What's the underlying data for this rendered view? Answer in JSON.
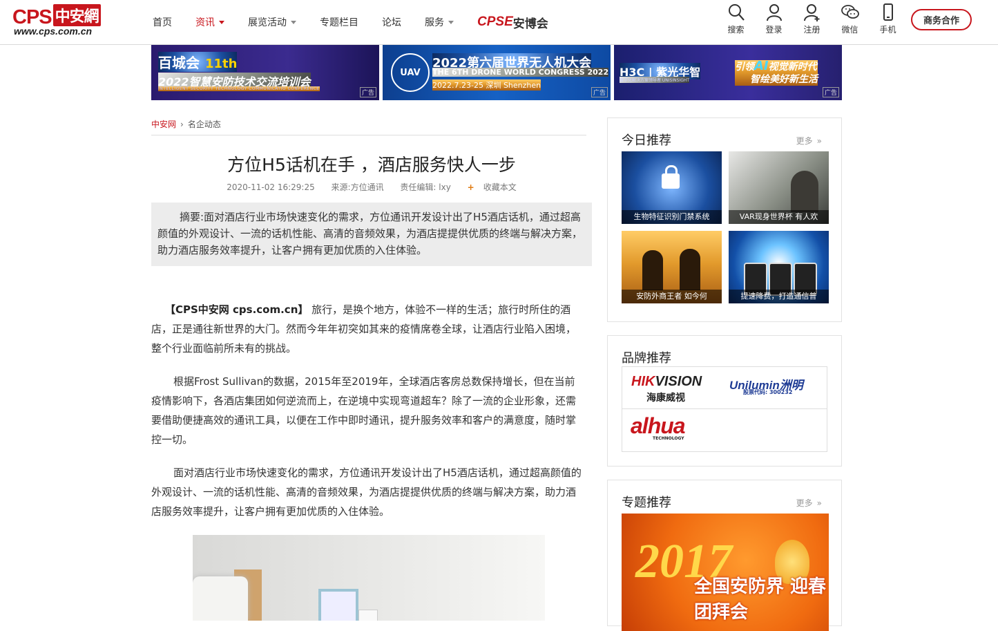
{
  "header": {
    "logo_cps": "CPS",
    "logo_cn": "中安網",
    "logo_url": "www.cps.com.cn",
    "nav": [
      {
        "label": "首页"
      },
      {
        "label": "资讯"
      },
      {
        "label": "展览活动"
      },
      {
        "label": "专题栏目"
      },
      {
        "label": "论坛"
      },
      {
        "label": "服务"
      }
    ],
    "cpse_c": "CPSE",
    "cpse_text": "安博会",
    "tools": [
      {
        "label": "搜索",
        "icon": "search-icon"
      },
      {
        "label": "登录",
        "icon": "user-icon"
      },
      {
        "label": "注册",
        "icon": "user-add-icon"
      },
      {
        "label": "微信",
        "icon": "wechat-icon"
      },
      {
        "label": "手机",
        "icon": "phone-icon"
      }
    ],
    "biz_button": "商务合作"
  },
  "ads": {
    "tag": "广告",
    "ad1": {
      "brand": "百城会",
      "num": "11th",
      "title": "2022智慧安防技术交流培训会",
      "sub": "INTELLIGENT SECURITY TECHNOLOGY COMMUNICATIO CONFERENCE"
    },
    "ad2": {
      "ring": "UAV",
      "title": "2022第六届世界无人机大会",
      "en": "THE 6TH DRONE WORLD CONGRESS 2022",
      "date": "2022.7.23-25   深圳  Shenzhen"
    },
    "ad3": {
      "brand": "H3C | 紫光华智",
      "sub": "数字化解决方案领导者  UNISINSIGHT",
      "line1a": "引领",
      "line1b": "AI",
      "line1c": "视觉新时代",
      "line2": "智绘美好新生活"
    }
  },
  "article": {
    "crumb_home": "中安网",
    "crumb_section": "名企动态",
    "title": "方位H5话机在手 ，酒店服务快人一步",
    "date": "2020-11-02 16:29:25",
    "source": "来源:方位通讯",
    "editor": "责任编辑: lxy",
    "favorite": "收藏本文",
    "summary": "摘要:面对酒店行业市场快速变化的需求，方位通讯开发设计出了H5酒店话机，通过超高颜值的外观设计、一流的话机性能、高清的音频效果，为酒店提提供优质的终端与解决方案，助力酒店服务效率提升，让客户拥有更加优质的入住体验。",
    "p1_lead": "【CPS中安网 cps.com.cn】",
    "p1_body": "  旅行，是换个地方，体验不一样的生活；旅行时所住的酒店，正是通往新世界的大门。然而今年年初突如其来的疫情席卷全球，让酒店行业陷入困境，整个行业面临前所未有的挑战。",
    "p2": "根据Frost Sullivan的数据，2015年至2019年，全球酒店客房总数保持增长，但在当前疫情影响下，各酒店集团如何逆流而上，在逆境中实现弯道超车？除了一流的企业形象，还需要借助便捷高效的通讯工具，以便在工作中即时通讯，提升服务效率和客户的满意度，随时掌控一切。",
    "p3": "面对酒店行业市场快速变化的需求，方位通讯开发设计出了H5酒店话机，通过超高颜值的外观设计、一流的话机性能、高清的音频效果，为酒店提提供优质的终端与解决方案，助力酒店服务效率提升，让客户拥有更加优质的入住体验。"
  },
  "sidebar": {
    "today": {
      "title": "今日推荐",
      "more": "更多",
      "items": [
        {
          "caption": "生物特征识别门禁系统"
        },
        {
          "caption": "VAR现身世界杯 有人欢"
        },
        {
          "caption": "安防外商王者 如今何"
        },
        {
          "caption": "提速降费，打造通信普"
        }
      ]
    },
    "brands": {
      "title": "品牌推荐",
      "hik_a": "HIK",
      "hik_b": "VISION",
      "hik_cn": "海康威视",
      "uni": "Unilumin洲明",
      "uni_code": "股票代码: 300232",
      "dahua_a": "alhua",
      "dahua_sub": "TECHNOLOGY"
    },
    "topics": {
      "title": "专题推荐",
      "more": "更多",
      "year": "2017",
      "text": "全国安防界 迎春团拜会"
    }
  },
  "colors": {
    "brand_red": "#c8161d",
    "accent_orange": "#e07a10"
  }
}
